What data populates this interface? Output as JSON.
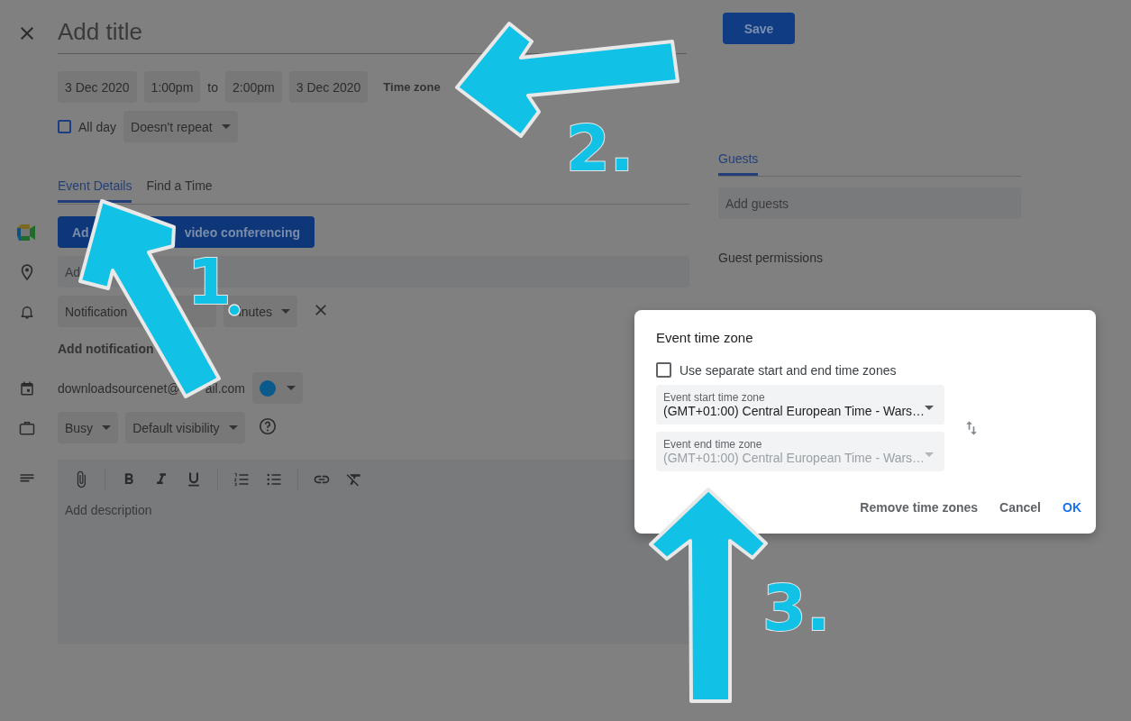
{
  "header": {
    "title_placeholder": "Add title",
    "save": "Save"
  },
  "datetime": {
    "start_date": "3 Dec 2020",
    "start_time": "1:00pm",
    "separator": "to",
    "end_time": "2:00pm",
    "end_date": "3 Dec 2020",
    "time_zone": "Time zone"
  },
  "all_day": {
    "label": "All day",
    "checked": false
  },
  "repeat": "Doesn't repeat",
  "tabs": [
    {
      "label": "Event Details",
      "selected": true
    },
    {
      "label": "Find a Time",
      "selected": false
    }
  ],
  "conferencing": {
    "visible_parts": [
      "Ad",
      "video conferencing"
    ]
  },
  "location": {
    "placeholder": "Ad"
  },
  "notification": {
    "type": "Notification",
    "unit": "inutes"
  },
  "add_notification": "Add notification",
  "calendar": {
    "owner_parts": [
      "downloadsourcenet@",
      "ail.com"
    ]
  },
  "availability": "Busy",
  "visibility": "Default visibility",
  "description": {
    "placeholder": "Add description"
  },
  "guests": {
    "tab": {
      "label": "Guests",
      "selected": true
    },
    "placeholder": "Add guests",
    "permissions_heading": "Guest permissions"
  },
  "dialog": {
    "title": "Event time zone",
    "separate": {
      "label": "Use separate start and end time zones",
      "checked": false
    },
    "fields": [
      {
        "label": "Event start time zone",
        "value": "(GMT+01:00) Central European Time - Wars…",
        "disabled": false
      },
      {
        "label": "Event end time zone",
        "value": "(GMT+01:00) Central European Time - Wars…",
        "disabled": true
      }
    ],
    "buttons": [
      {
        "label": "Remove time zones",
        "kind": "text"
      },
      {
        "label": "Cancel",
        "kind": "text"
      },
      {
        "label": "OK",
        "kind": "primary"
      }
    ]
  },
  "annotations": [
    {
      "label": "1"
    },
    {
      "label": "2."
    },
    {
      "label": "3."
    }
  ]
}
